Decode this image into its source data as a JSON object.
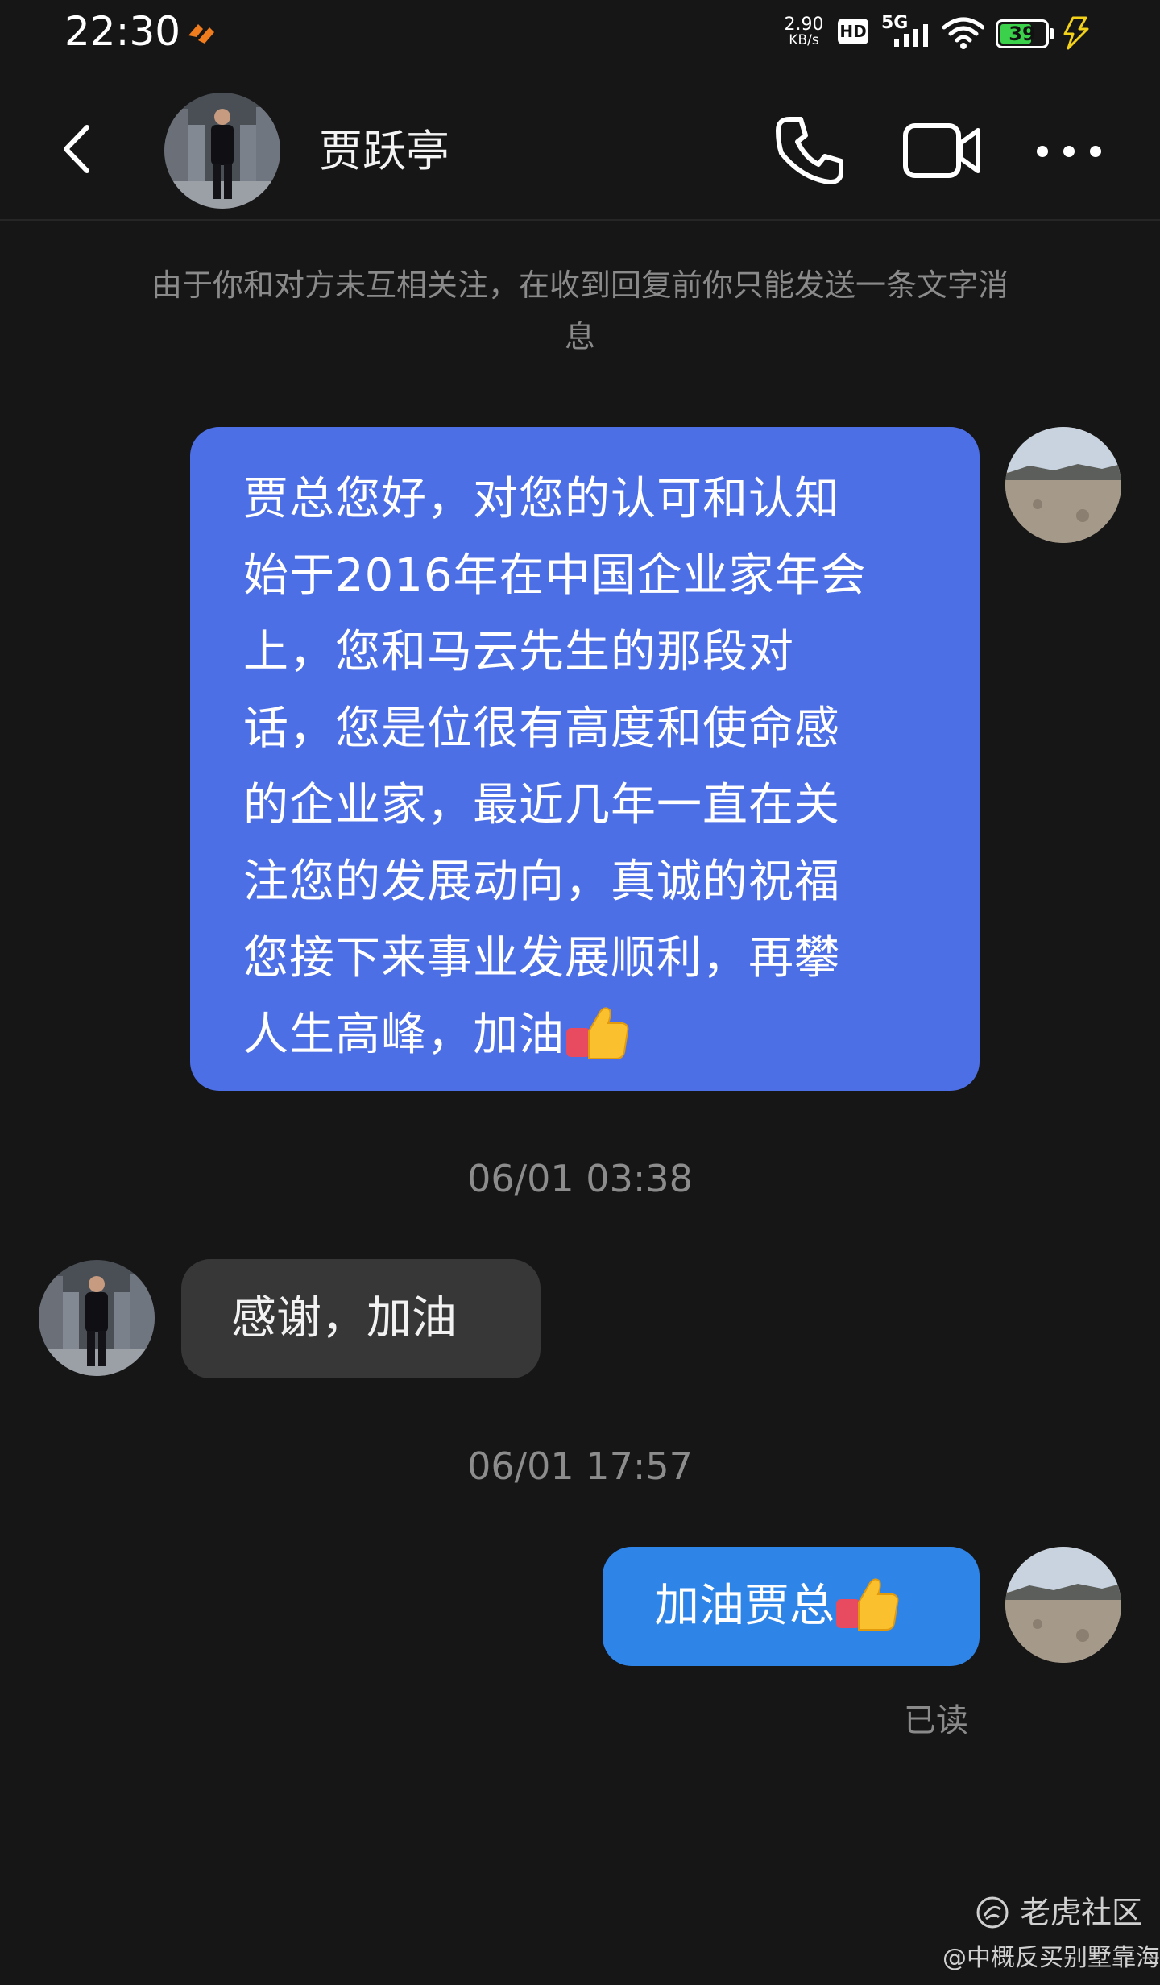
{
  "status_bar": {
    "time": "22:30",
    "net_speed_value": "2.90",
    "net_speed_unit": "KB/s",
    "hd_label": "HD",
    "network_type": "5G",
    "battery_level": "39",
    "icons": [
      "app-notification-icon",
      "hd-icon",
      "signal-icon",
      "wifi-icon",
      "battery-icon",
      "charging-icon"
    ]
  },
  "header": {
    "contact_name": "贾跃亭",
    "icons": [
      "back-icon",
      "phone-icon",
      "video-call-icon",
      "more-icon"
    ]
  },
  "notice": "由于你和对方未互相关注，在收到回复前你只能发送一条文字消息",
  "messages": [
    {
      "sender": "me",
      "text_lines": [
        "贾总您好，对您的认可和认知",
        "始于2016年在中国企业家年会",
        "上，您和马云先生的那段对",
        "话，您是位很有高度和使命感",
        "的企业家，最近几年一直在关",
        "注您的发展动向，真诚的祝福",
        "您接下来事业发展顺利，再攀",
        "人生高峰，加油"
      ],
      "emoji": "thumbs-up-icon"
    },
    {
      "timestamp": "06/01 03:38"
    },
    {
      "sender": "contact",
      "text": "感谢，加油"
    },
    {
      "timestamp": "06/01 17:57"
    },
    {
      "sender": "me",
      "text": "加油贾总",
      "emoji": "thumbs-up-icon",
      "status": "已读"
    }
  ],
  "watermark": {
    "app_name": "老虎社区",
    "user": "@中概反买别墅靠海"
  },
  "colors": {
    "background": "#161616",
    "my_bubble_long": "#4d6fe6",
    "my_bubble_short": "#2f84e8",
    "contact_bubble": "#373737",
    "muted_text": "#8a8a8a"
  }
}
